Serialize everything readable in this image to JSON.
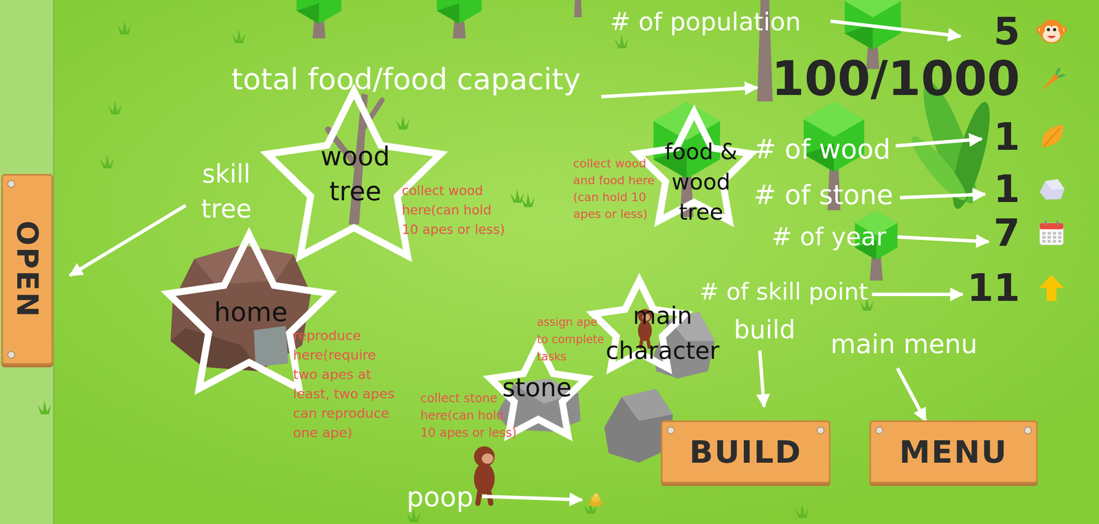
{
  "sidebar": {
    "tab": "OPEN"
  },
  "stats": [
    {
      "kind": "population",
      "value": "5"
    },
    {
      "kind": "food",
      "value": "100/1000"
    },
    {
      "kind": "wood",
      "value": "1"
    },
    {
      "kind": "stone",
      "value": "1"
    },
    {
      "kind": "year",
      "value": "7"
    },
    {
      "kind": "skill",
      "value": "11"
    }
  ],
  "buttons": [
    "BUILD",
    "MENU"
  ],
  "labels": [
    {
      "lines": [
        "# of population"
      ]
    },
    {
      "lines": [
        "total food/food capacity"
      ]
    },
    {
      "lines": [
        "skill",
        "tree"
      ]
    },
    {
      "lines": [
        "# of wood"
      ]
    },
    {
      "lines": [
        "# of stone"
      ]
    },
    {
      "lines": [
        "# of year"
      ]
    },
    {
      "lines": [
        "# of skill point"
      ]
    },
    {
      "lines": [
        "build"
      ]
    },
    {
      "lines": [
        "main menu"
      ]
    },
    {
      "lines": [
        "poop"
      ]
    }
  ],
  "stars": [
    {
      "lines": [
        "wood",
        "tree"
      ]
    },
    {
      "lines": [
        "food &",
        "wood",
        "tree"
      ]
    },
    {
      "lines": [
        "home"
      ]
    },
    {
      "lines": [
        "stone"
      ]
    },
    {
      "lines": [
        "main",
        "character"
      ]
    }
  ],
  "notes": [
    {
      "lines": [
        "collect wood",
        "here(can hold",
        "10 apes or less)"
      ]
    },
    {
      "lines": [
        "collect wood",
        "and food here",
        "(can hold 10",
        "apes or less)"
      ]
    },
    {
      "lines": [
        "reproduce",
        "here(require",
        "two apes at",
        "least, two apes",
        "can reproduce",
        "one ape)"
      ]
    },
    {
      "lines": [
        "collect stone",
        "here(can hold",
        "10 apes or less)"
      ]
    },
    {
      "lines": [
        "assign ape",
        "to complete",
        "tasks"
      ]
    }
  ]
}
